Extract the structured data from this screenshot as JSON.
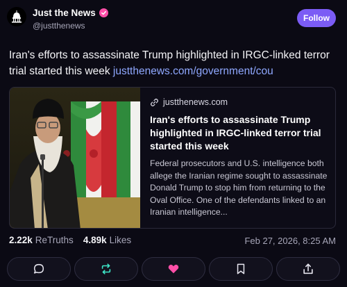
{
  "account": {
    "display_name": "Just the News",
    "handle": "@justthenews",
    "follow_label": "Follow",
    "verified": true
  },
  "post": {
    "text": "Iran's efforts to assassinate Trump highlighted in IRGC-linked terror trial started this week ",
    "link_text": "justthenews.com/government/cou"
  },
  "card": {
    "domain": "justthenews.com",
    "title": "Iran's efforts to assassinate Trump highlighted in IRGC-linked terror trial started this week",
    "description": "Federal prosecutors and U.S. intelligence both allege the Iranian regime sought to assassinate Donald Trump to stop him from returning to the Oval Office. One of the defendants linked to an Iranian intelligence..."
  },
  "stats": {
    "retruths_count": "2.22k",
    "retruths_label": "ReTruths",
    "likes_count": "4.89k",
    "likes_label": "Likes",
    "timestamp": "Feb 27, 2026, 8:25 AM"
  },
  "colors": {
    "background": "#0b0a14",
    "accent": "#7b5cf5",
    "link": "#8fa8ff",
    "verified": "#ff4fa8",
    "like": "#ff4fa8",
    "retruth": "#3ee6c8"
  },
  "icons": {
    "avatar": "capitol-dome-icon",
    "verified": "checkmark-badge-icon",
    "domain": "link-icon",
    "reply": "speech-bubble-icon",
    "retruth": "repost-arrows-icon",
    "like": "heart-icon",
    "bookmark": "bookmark-icon",
    "share": "share-upload-icon"
  }
}
